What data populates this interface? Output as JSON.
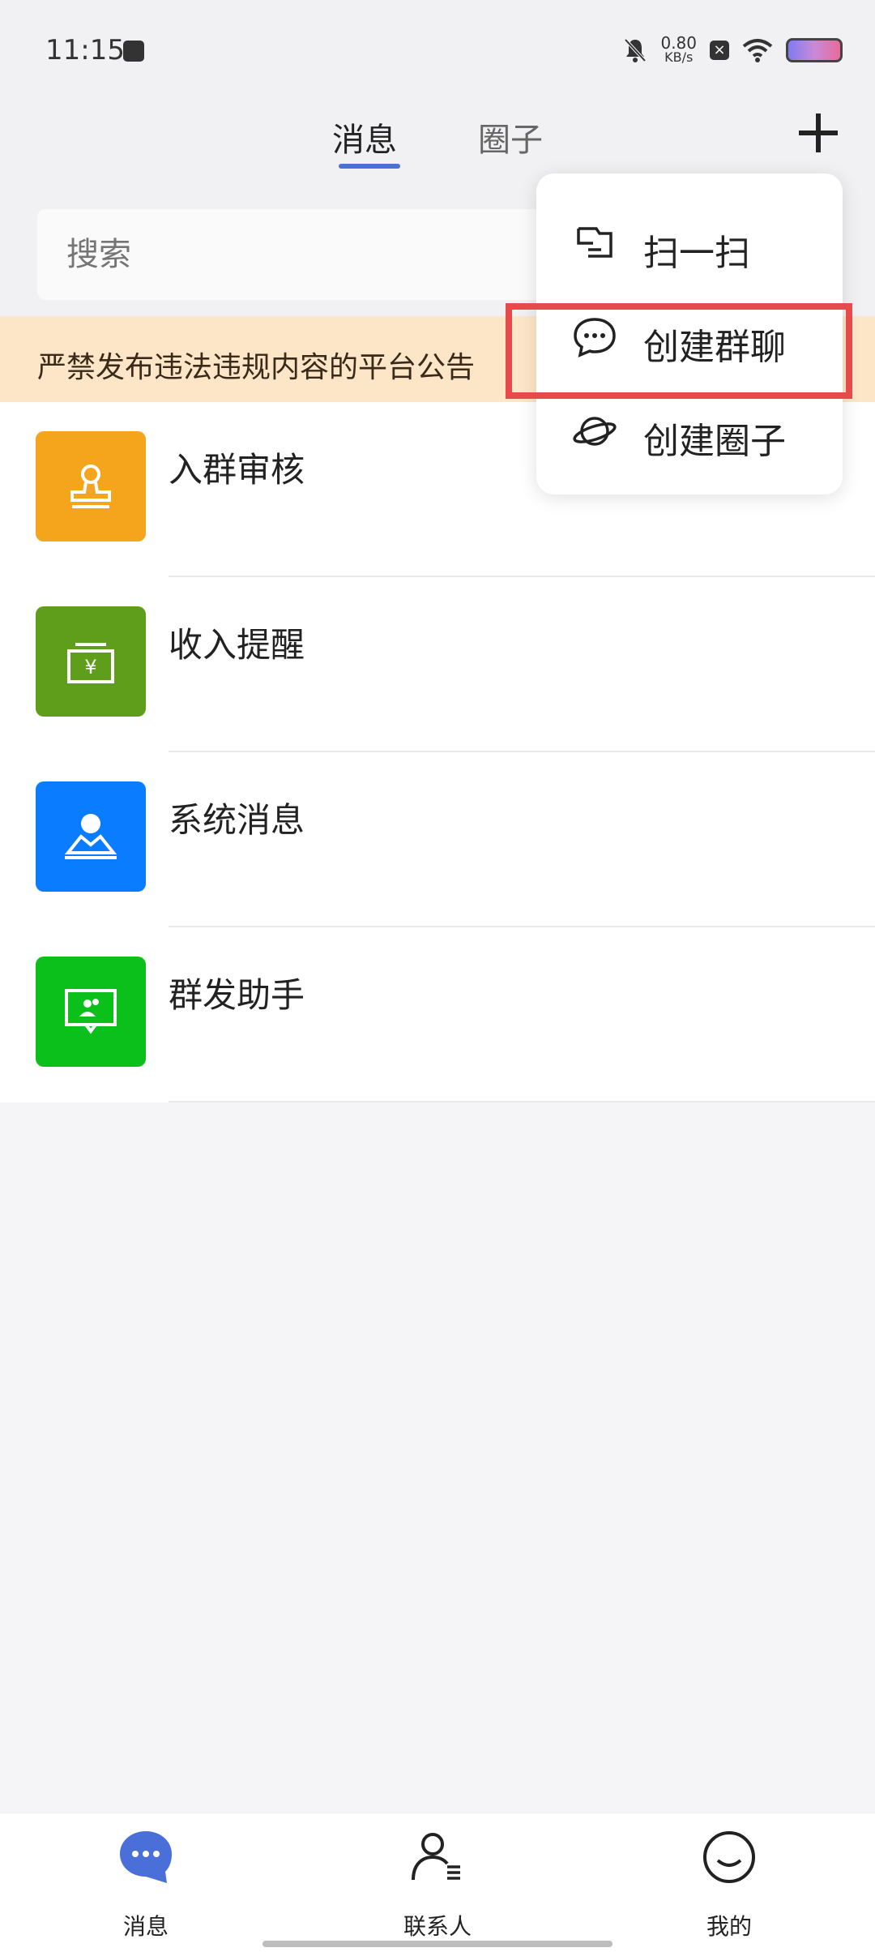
{
  "status_bar": {
    "time": "11:15",
    "speed_value": "0.80",
    "speed_unit": "KB/s",
    "icons": [
      "app-icon",
      "bell-muted-icon",
      "close-icon",
      "wifi-icon",
      "battery-icon"
    ]
  },
  "header": {
    "tabs": [
      {
        "label": "消息",
        "active": true
      },
      {
        "label": "圈子",
        "active": false
      }
    ],
    "add_icon": "plus-icon",
    "active_color": "#4a6fd8"
  },
  "search": {
    "placeholder": "搜索"
  },
  "notice": {
    "text": "严禁发布违法违规内容的平台公告"
  },
  "list": {
    "items": [
      {
        "label": "入群审核",
        "icon": "stamp-icon",
        "color": "#f4a51c"
      },
      {
        "label": "收入提醒",
        "icon": "yuan-wallet-icon",
        "color": "#5e9e1a"
      },
      {
        "label": "系统消息",
        "icon": "user-card-icon",
        "color": "#0a7cff"
      },
      {
        "label": "群发助手",
        "icon": "broadcast-icon",
        "color": "#0cc01c"
      }
    ]
  },
  "dropdown": {
    "items": [
      {
        "label": "扫一扫",
        "icon": "scan-icon"
      },
      {
        "label": "创建群聊",
        "icon": "chat-bubble-icon"
      },
      {
        "label": "创建圈子",
        "icon": "planet-icon"
      }
    ],
    "highlight_color": "#e64a4a"
  },
  "bottom_nav": {
    "items": [
      {
        "label": "消息",
        "icon": "message-icon",
        "active": true
      },
      {
        "label": "联系人",
        "icon": "contacts-icon",
        "active": false
      },
      {
        "label": "我的",
        "icon": "smiley-icon",
        "active": false
      }
    ],
    "active_color": "#4a6fd8"
  }
}
